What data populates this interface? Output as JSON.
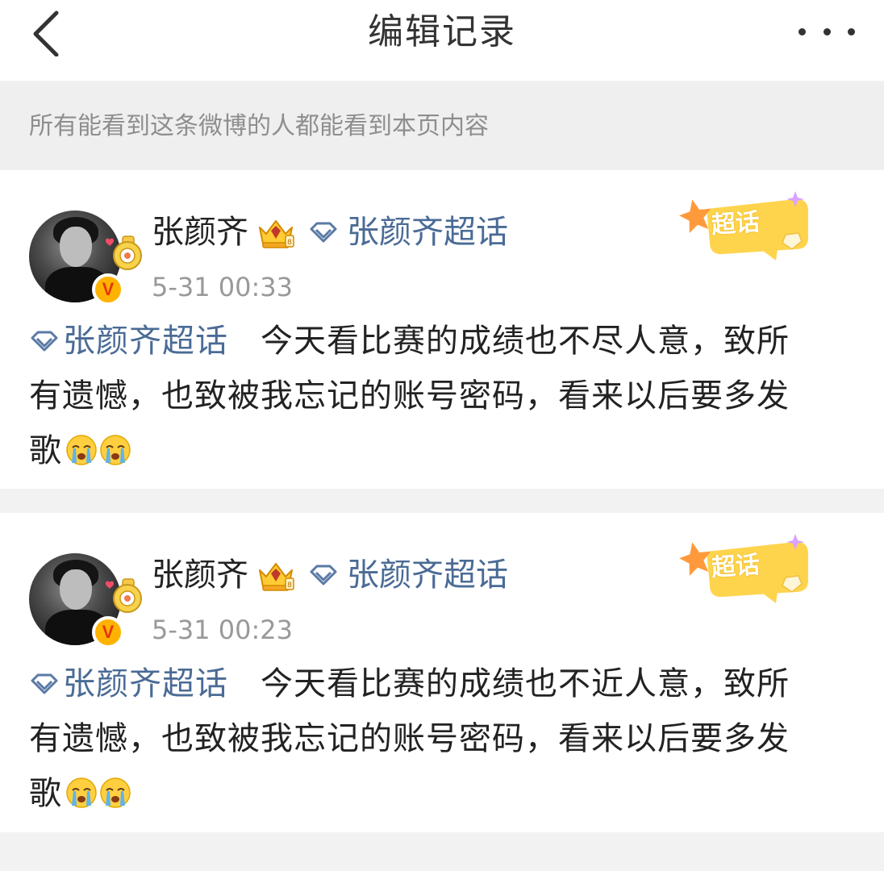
{
  "header": {
    "title": "编辑记录",
    "back_icon": "chevron-left-icon",
    "more_icon": "more-dots-icon"
  },
  "notice": {
    "text": "所有能看到这条微博的人都能看到本页内容"
  },
  "colors": {
    "topic_link": "#4a6b95",
    "timestamp": "#999999",
    "notice_text": "#8e8e8e",
    "verified_badge": "#ffb300"
  },
  "records": [
    {
      "user_name": "张颜齐",
      "topic_name": "张颜齐超话",
      "super_badge_label": "超话",
      "timestamp": "5-31 00:33",
      "inline_topic": "张颜齐超话",
      "body_line1": "今天看比赛的成绩也不尽人意，致所",
      "body_line2": "有遗憾，也致被我忘记的账号密码，看来以后要多发",
      "body_line3": "歌",
      "emoji_count": 2,
      "emoji_icon": "crying-face-icon"
    },
    {
      "user_name": "张颜齐",
      "topic_name": "张颜齐超话",
      "super_badge_label": "超话",
      "timestamp": "5-31 00:23",
      "inline_topic": "张颜齐超话",
      "body_line1": "今天看比赛的成绩也不近人意，致所",
      "body_line2": "有遗憾，也致被我忘记的账号密码，看来以后要多发",
      "body_line3": "歌",
      "emoji_count": 2,
      "emoji_icon": "crying-face-icon"
    }
  ]
}
